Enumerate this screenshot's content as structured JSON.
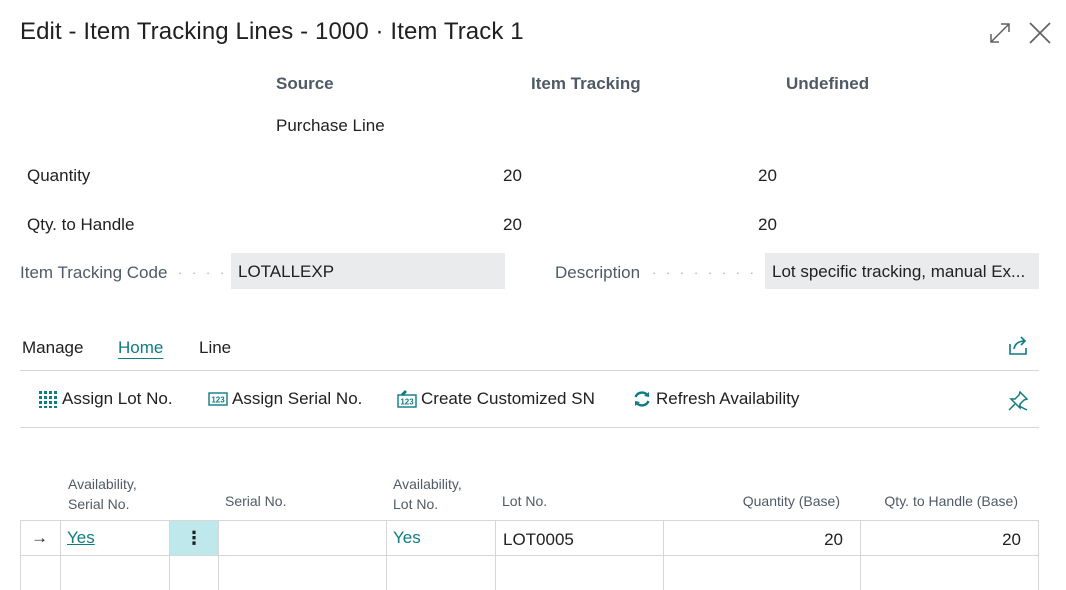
{
  "window": {
    "title": "Edit - Item Tracking Lines - 1000 · Item Track 1",
    "expand_icon": "expand-icon",
    "close_icon": "close-icon"
  },
  "summary": {
    "headers": {
      "source": "Source",
      "item_tracking": "Item Tracking",
      "undefined": "Undefined"
    },
    "source_value": "Purchase Line",
    "rows": [
      {
        "label": "Quantity",
        "item_tracking": "20",
        "undefined": "20"
      },
      {
        "label": "Qty. to Handle",
        "item_tracking": "20",
        "undefined": "20"
      }
    ]
  },
  "fields": {
    "item_tracking_code": {
      "label": "Item Tracking Code",
      "value": "LOTALLEXP"
    },
    "description": {
      "label": "Description",
      "value": "Lot specific tracking, manual Ex..."
    }
  },
  "tabs": [
    {
      "label": "Manage",
      "active": false
    },
    {
      "label": "Home",
      "active": true
    },
    {
      "label": "Line",
      "active": false
    }
  ],
  "actions": [
    {
      "label": "Assign Lot No.",
      "icon": "grid-icon"
    },
    {
      "label": "Assign Serial No.",
      "icon": "serial-number-icon"
    },
    {
      "label": "Create Customized SN",
      "icon": "customized-serial-icon"
    },
    {
      "label": "Refresh Availability",
      "icon": "refresh-icon"
    }
  ],
  "grid": {
    "columns": {
      "avail_serial": "Availability,\nSerial No.",
      "serial_no": "Serial No.",
      "avail_lot": "Availability,\nLot No.",
      "lot_no": "Lot No.",
      "quantity_base": "Quantity (Base)",
      "qty_to_handle_base": "Qty. to Handle (Base)"
    },
    "rows": [
      {
        "indicator": "→",
        "avail_serial": "Yes",
        "menu": "⋮",
        "serial_no": "",
        "avail_lot": "Yes",
        "lot_no": "LOT0005",
        "quantity_base": "20",
        "qty_to_handle_base": "20"
      }
    ]
  },
  "colors": {
    "accent": "#0f7b83",
    "selected_cell": "#bfe8ed",
    "field_bg": "#eaebec"
  }
}
